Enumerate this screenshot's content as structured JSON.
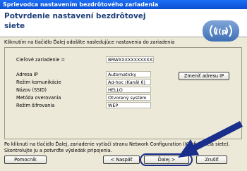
{
  "window": {
    "title": "Sprievodca nastavením bezdrôtového zariadenia"
  },
  "header": {
    "title": "Potvrdenie nastavení bezdrôtovej siete",
    "logo_icon": "wireless-icon"
  },
  "intro": "Kliknutím na tlačidlo Ďalej odošlite nasledujúce nastavenia do zariadenia",
  "settings": {
    "target_label": "Cieľové zariadenie =",
    "target_value": "BRWXXXXXXXXXXXX",
    "rows": [
      {
        "label": "Adresa IP",
        "value": "Automaticky"
      },
      {
        "label": "Režim komunikácie",
        "value": "Ad-hoc (Kanál 6)"
      },
      {
        "label": "Názov (SSID)",
        "value": "HELLO"
      },
      {
        "label": "Metóda overovania",
        "value": "Otvorený systém"
      },
      {
        "label": "Režim šifrovania",
        "value": "WEP"
      }
    ],
    "change_ip_button": "Zmeniť adresu IP"
  },
  "note": {
    "line1": "Po kliknutí na tlačidlo Ďalej, zariadenie vytlačí stranu Network Configuration (Konfigurácia siete).",
    "line2": "Skontrolujte ju a potvrďte výsledok pripojenia."
  },
  "buttons": {
    "help": "Pomocník",
    "back": "< Naspäť",
    "next": "Ďalej >",
    "cancel": "Zrušiť"
  },
  "colors": {
    "title_bar": "#0a4fd2",
    "header_title": "#1f3f7a",
    "arrow": "#1a2e8c"
  }
}
